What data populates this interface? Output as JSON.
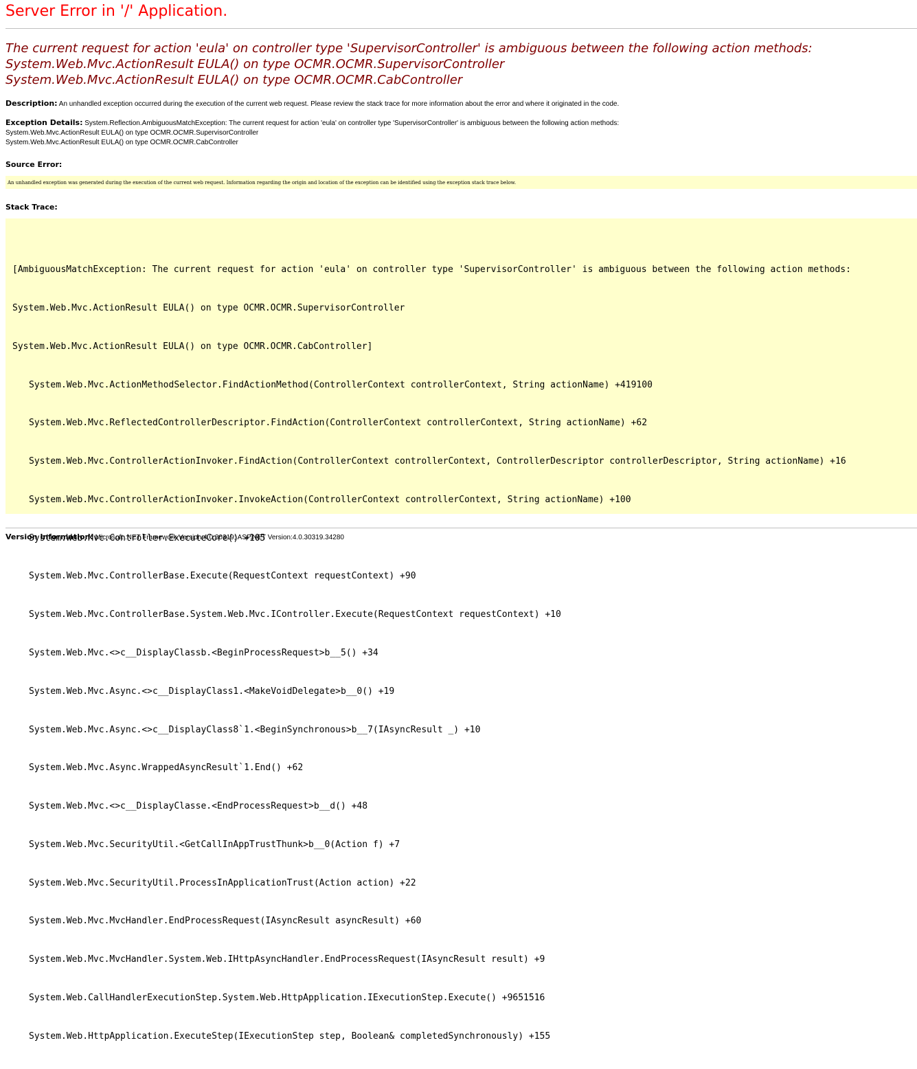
{
  "page": {
    "title": "Server Error in '/' Application."
  },
  "exception_message": {
    "lines": [
      "The current request for action 'eula' on controller type 'SupervisorController' is ambiguous between the following action methods:",
      "System.Web.Mvc.ActionResult EULA() on type OCMR.OCMR.SupervisorController",
      "System.Web.Mvc.ActionResult EULA() on type OCMR.OCMR.CabController"
    ]
  },
  "description": {
    "label": "Description:",
    "text": "An unhandled exception occurred during the execution of the current web request. Please review the stack trace for more information about the error and where it originated in the code."
  },
  "exception_details": {
    "label": "Exception Details:",
    "first_line": "System.Reflection.AmbiguousMatchException: The current request for action 'eula' on controller type 'SupervisorController' is ambiguous between the following action methods:",
    "lines": [
      "System.Web.Mvc.ActionResult EULA() on type OCMR.OCMR.SupervisorController",
      "System.Web.Mvc.ActionResult EULA() on type OCMR.OCMR.CabController"
    ]
  },
  "source_error": {
    "label": "Source Error:",
    "text": "An unhandled exception was generated during the execution of the current web request. Information regarding the origin and location of the exception can be identified using the exception stack trace below."
  },
  "stack_trace": {
    "label": "Stack Trace:",
    "header_lines": [
      "[AmbiguousMatchException: The current request for action 'eula' on controller type 'SupervisorController' is ambiguous between the following action methods:",
      "System.Web.Mvc.ActionResult EULA() on type OCMR.OCMR.SupervisorController",
      "System.Web.Mvc.ActionResult EULA() on type OCMR.OCMR.CabController]"
    ],
    "frames": [
      "System.Web.Mvc.ActionMethodSelector.FindActionMethod(ControllerContext controllerContext, String actionName) +419100",
      "System.Web.Mvc.ReflectedControllerDescriptor.FindAction(ControllerContext controllerContext, String actionName) +62",
      "System.Web.Mvc.ControllerActionInvoker.FindAction(ControllerContext controllerContext, ControllerDescriptor controllerDescriptor, String actionName) +16",
      "System.Web.Mvc.ControllerActionInvoker.InvokeAction(ControllerContext controllerContext, String actionName) +100",
      "System.Web.Mvc.Controller.ExecuteCore() +105",
      "System.Web.Mvc.ControllerBase.Execute(RequestContext requestContext) +90",
      "System.Web.Mvc.ControllerBase.System.Web.Mvc.IController.Execute(RequestContext requestContext) +10",
      "System.Web.Mvc.<>c__DisplayClassb.<BeginProcessRequest>b__5() +34",
      "System.Web.Mvc.Async.<>c__DisplayClass1.<MakeVoidDelegate>b__0() +19",
      "System.Web.Mvc.Async.<>c__DisplayClass8`1.<BeginSynchronous>b__7(IAsyncResult _) +10",
      "System.Web.Mvc.Async.WrappedAsyncResult`1.End() +62",
      "System.Web.Mvc.<>c__DisplayClasse.<EndProcessRequest>b__d() +48",
      "System.Web.Mvc.SecurityUtil.<GetCallInAppTrustThunk>b__0(Action f) +7",
      "System.Web.Mvc.SecurityUtil.ProcessInApplicationTrust(Action action) +22",
      "System.Web.Mvc.MvcHandler.EndProcessRequest(IAsyncResult asyncResult) +60",
      "System.Web.Mvc.MvcHandler.System.Web.IHttpAsyncHandler.EndProcessRequest(IAsyncResult result) +9",
      "System.Web.CallHandlerExecutionStep.System.Web.HttpApplication.IExecutionStep.Execute() +9651516",
      "System.Web.HttpApplication.ExecuteStep(IExecutionStep step, Boolean& completedSynchronously) +155"
    ]
  },
  "version_info": {
    "label": "Version Information:",
    "text": "Microsoft .NET Framework Version:4.0.30319; ASP.NET Version:4.0.30319.34280"
  },
  "colors": {
    "title": "#ff0000",
    "exception": "#800000",
    "code_background": "#ffffcc",
    "rule": "#c0c0c0"
  }
}
